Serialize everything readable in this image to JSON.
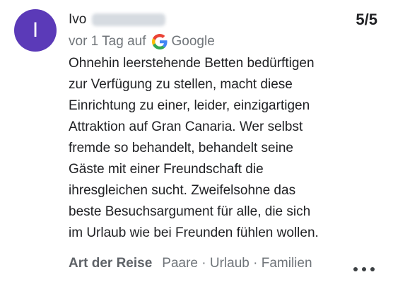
{
  "review": {
    "avatar_letter": "I",
    "avatar_color": "#5b3ab8",
    "author_first_name": "Ivo",
    "score": "5/5",
    "time_ago": "vor 1 Tag auf",
    "source_name": "Google",
    "source_icon": "google-g-icon",
    "text": "Ohnehin leerstehende Betten bedürftigen\nzur Verfügung zu stellen, macht diese\nEinrichtung zu einer, leider, einzigartigen\nAttraktion auf Gran Canaria. Wer selbst\nfremde so behandelt, behandelt seine\nGäste mit einer Freundschaft die\nihresgleichen sucht. Zweifelsohne das\nbeste Besuchsargument für alle, die sich\nim Urlaub wie bei Freunden fühlen wollen.",
    "trip_type_label": "Art der Reise",
    "trip_type_values": "Paare · Urlaub · Familien",
    "more_icon": "more-horizontal-icon"
  }
}
